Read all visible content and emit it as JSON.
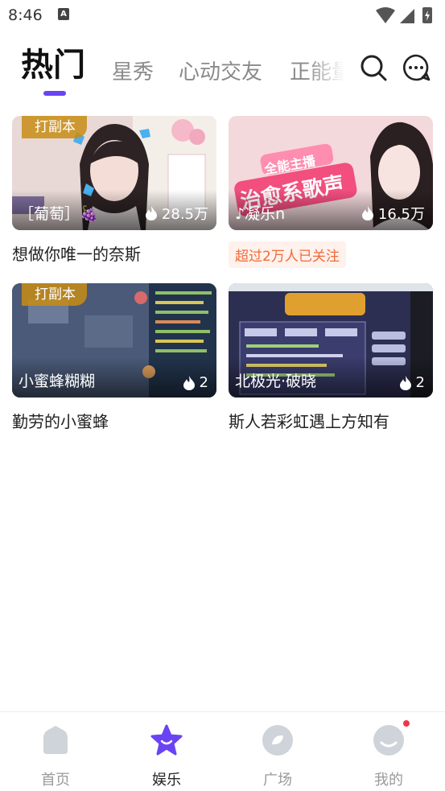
{
  "status_bar": {
    "time": "8:46",
    "notification_icon": "A"
  },
  "tabs": [
    {
      "label": "热门",
      "active": true
    },
    {
      "label": "星秀",
      "active": false
    },
    {
      "label": "心动交友",
      "active": false
    },
    {
      "label": "正能量",
      "active": false
    }
  ],
  "header_icons": [
    "search-icon",
    "message-icon"
  ],
  "cards": [
    {
      "badge": "打副本",
      "streamer": "［葡萄］🍇",
      "views": "28.5万",
      "title": "想做你唯一的奈斯"
    },
    {
      "badge": "",
      "streamer": "♪凝乐n",
      "views": "16.5万",
      "title": "",
      "follow_tag": "超过2万人已关注",
      "overlay_text": "全能主播 治愈系歌声"
    },
    {
      "badge": "打副本",
      "streamer": "小蜜蜂糊糊",
      "views": "2",
      "title": "勤劳的小蜜蜂"
    },
    {
      "badge": "",
      "streamer": "北极光·破晓",
      "views": "2",
      "title": "斯人若彩虹遇上方知有"
    }
  ],
  "bottom_nav": [
    {
      "label": "首页",
      "icon": "home-icon",
      "active": false
    },
    {
      "label": "娱乐",
      "icon": "star-icon",
      "active": true
    },
    {
      "label": "广场",
      "icon": "square-icon",
      "active": false
    },
    {
      "label": "我的",
      "icon": "profile-icon",
      "active": false,
      "has_dot": true
    }
  ],
  "colors": {
    "accent": "#6a44f2",
    "badge": "#c88c14",
    "follow_tag_text": "#f06a3a",
    "follow_tag_bg": "#fff1ec",
    "notification_dot": "#f2344a"
  }
}
